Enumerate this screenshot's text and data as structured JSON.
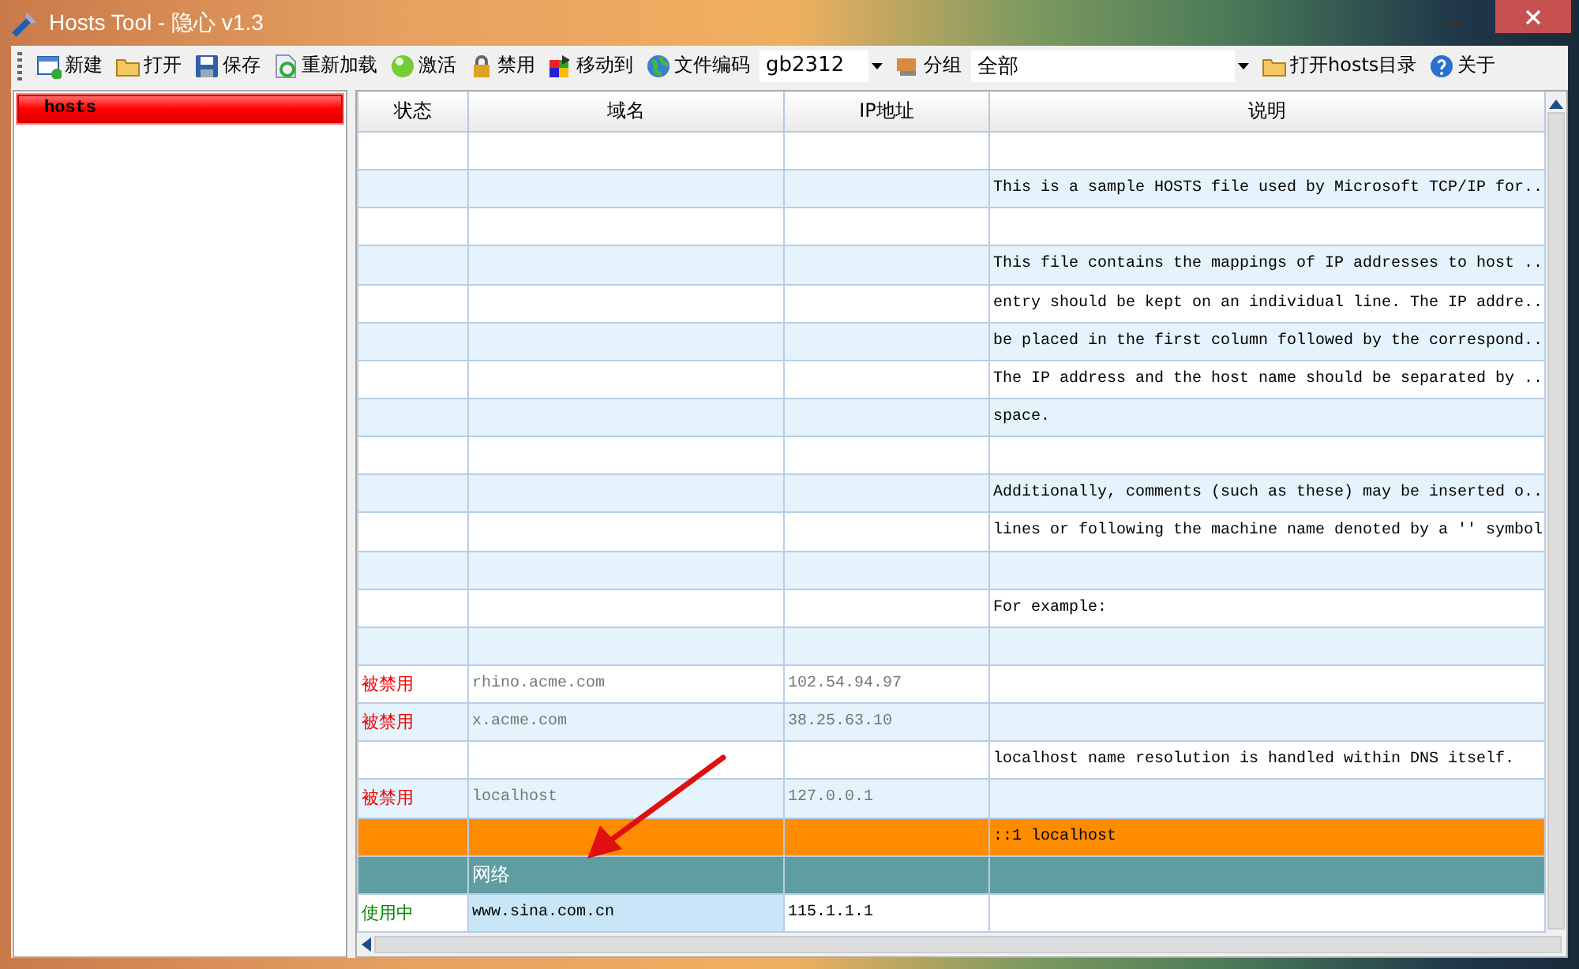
{
  "window": {
    "title": "Hosts Tool - 隐心 v1.3"
  },
  "toolbar": {
    "buttons_before": [
      "新建",
      "打开",
      "保存",
      "重新加载",
      "激活",
      "禁用",
      "移动到",
      "文件编码"
    ],
    "encoding": "gb2312",
    "group_label": "分组",
    "group_value": "全部",
    "buttons_after": [
      "打开hosts目录",
      "关于"
    ]
  },
  "sidebar": {
    "items": [
      {
        "label": "hosts",
        "selected": true
      }
    ]
  },
  "table": {
    "columns": [
      "状态",
      "域名",
      "IP地址",
      "说明"
    ],
    "rows": [
      {
        "kind": "plain",
        "status": "",
        "domain": "",
        "ip": "",
        "comment": ""
      },
      {
        "kind": "plain",
        "status": "",
        "domain": "",
        "ip": "",
        "comment": "This is a sample HOSTS file used by Microsoft TCP/IP for.."
      },
      {
        "kind": "plain",
        "status": "",
        "domain": "",
        "ip": "",
        "comment": ""
      },
      {
        "kind": "plain",
        "status": "",
        "domain": "",
        "ip": "",
        "comment": "This file contains the mappings of IP addresses to host .."
      },
      {
        "kind": "plain",
        "status": "",
        "domain": "",
        "ip": "",
        "comment": "entry should be kept on an individual line. The IP addre.."
      },
      {
        "kind": "plain",
        "status": "",
        "domain": "",
        "ip": "",
        "comment": "be placed in the first column followed by the correspond.."
      },
      {
        "kind": "plain",
        "status": "",
        "domain": "",
        "ip": "",
        "comment": "The IP address and the host name should be separated by .."
      },
      {
        "kind": "plain",
        "status": "",
        "domain": "",
        "ip": "",
        "comment": "space."
      },
      {
        "kind": "plain",
        "status": "",
        "domain": "",
        "ip": "",
        "comment": ""
      },
      {
        "kind": "plain",
        "status": "",
        "domain": "",
        "ip": "",
        "comment": "Additionally, comments (such as these) may be inserted o.."
      },
      {
        "kind": "plain",
        "status": "",
        "domain": "",
        "ip": "",
        "comment": "lines or following the machine name denoted by a '' symbol"
      },
      {
        "kind": "plain",
        "status": "",
        "domain": "",
        "ip": "",
        "comment": ""
      },
      {
        "kind": "plain",
        "status": "",
        "domain": "",
        "ip": "",
        "comment": "For example:"
      },
      {
        "kind": "plain",
        "status": "",
        "domain": "",
        "ip": "",
        "comment": ""
      },
      {
        "kind": "disabled",
        "status": "被禁用",
        "domain": "rhino.acme.com",
        "ip": "102.54.94.97",
        "comment": ""
      },
      {
        "kind": "disabled",
        "status": "被禁用",
        "domain": "x.acme.com",
        "ip": "38.25.63.10",
        "comment": ""
      },
      {
        "kind": "plain",
        "status": "",
        "domain": "",
        "ip": "",
        "comment": "localhost name resolution is handled within DNS itself."
      },
      {
        "kind": "disabled",
        "status": "被禁用",
        "domain": "localhost",
        "ip": "127.0.0.1",
        "comment": ""
      },
      {
        "kind": "highlight",
        "status": "",
        "domain": "",
        "ip": "",
        "comment": "::1 localhost"
      },
      {
        "kind": "group",
        "status": "",
        "domain": "网络",
        "ip": "",
        "comment": ""
      },
      {
        "kind": "active",
        "status": "使用中",
        "domain": "www.sina.com.cn",
        "ip": "115.1.1.1",
        "comment": "",
        "editing": true
      }
    ]
  }
}
